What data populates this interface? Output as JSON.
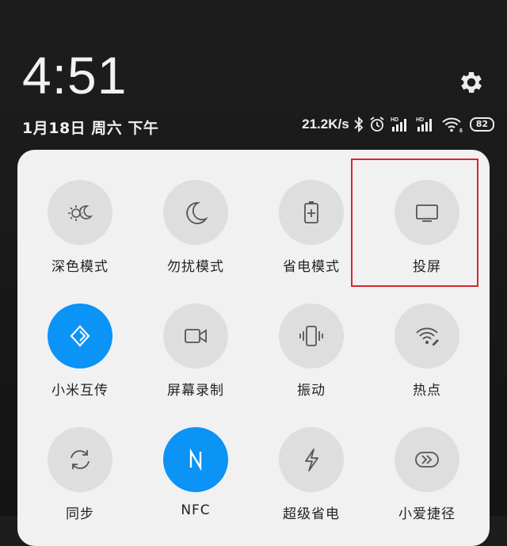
{
  "clock": "4:51",
  "date": "1月18日 周六 下午",
  "status": {
    "speed": "21.2K/s",
    "battery": "82",
    "icons": [
      "bluetooth-icon",
      "alarm-icon",
      "hd-signal-icon",
      "hd-signal-icon",
      "wifi-6-icon"
    ]
  },
  "colors": {
    "active": "#0b93f6",
    "highlight": "#d7262c"
  },
  "tiles": [
    {
      "label": "深色模式",
      "icon": "dark-mode-icon",
      "active": false
    },
    {
      "label": "勿扰模式",
      "icon": "moon-icon",
      "active": false
    },
    {
      "label": "省电模式",
      "icon": "battery-saver-icon",
      "active": false
    },
    {
      "label": "投屏",
      "icon": "screen-cast-icon",
      "active": false
    },
    {
      "label": "小米互传",
      "icon": "mi-share-icon",
      "active": true
    },
    {
      "label": "屏幕录制",
      "icon": "screen-record-icon",
      "active": false
    },
    {
      "label": "振动",
      "icon": "vibrate-icon",
      "active": false
    },
    {
      "label": "热点",
      "icon": "hotspot-icon",
      "active": false
    },
    {
      "label": "同步",
      "icon": "sync-icon",
      "active": false
    },
    {
      "label": "NFC",
      "icon": "nfc-icon",
      "active": true
    },
    {
      "label": "超级省电",
      "icon": "lightning-icon",
      "active": false
    },
    {
      "label": "小爱捷径",
      "icon": "xiaoai-shortcut-icon",
      "active": false
    }
  ]
}
